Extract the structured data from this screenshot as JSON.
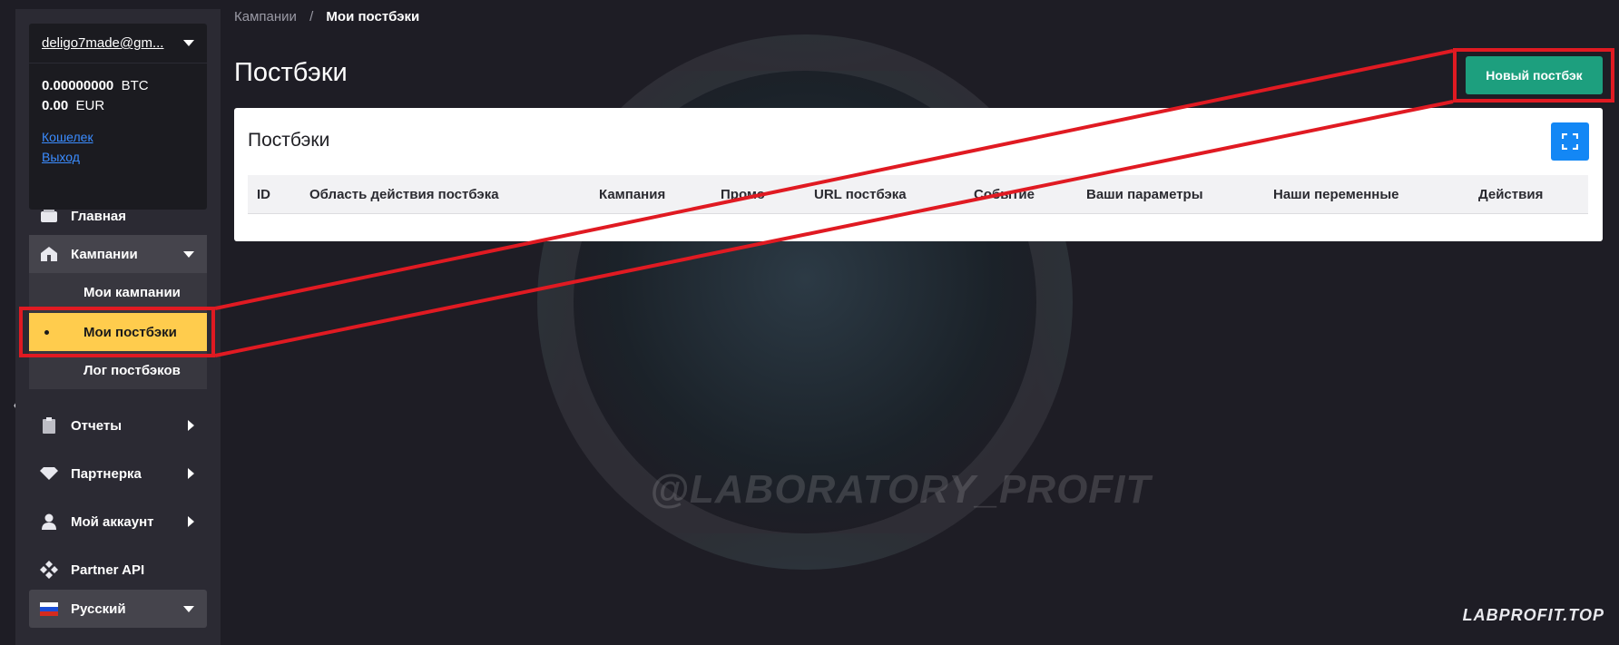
{
  "account": {
    "email": "deligo7made@gm...",
    "btc_amount": "0.00000000",
    "btc_currency": "BTC",
    "eur_amount": "0.00",
    "eur_currency": "EUR",
    "wallet_link": "Кошелек",
    "logout_link": "Выход"
  },
  "sidebar": {
    "home": "Главная",
    "campaigns": "Кампании",
    "campaigns_sub": [
      "Мои кампании",
      "Мои постбэки",
      "Лог постбэков"
    ],
    "reports": "Отчеты",
    "partner": "Партнерка",
    "my_account": "Мой аккаунт",
    "partner_api": "Partner API",
    "language": "Русский"
  },
  "breadcrumb": {
    "parent": "Кампании",
    "separator": "/",
    "current": "Мои постбэки"
  },
  "page": {
    "title": "Постбэки",
    "new_button": "Новый постбэк"
  },
  "card": {
    "title": "Постбэки",
    "columns": [
      "ID",
      "Область действия постбэка",
      "Кампания",
      "Промо",
      "URL постбэка",
      "Событие",
      "Ваши параметры",
      "Наши переменные",
      "Действия"
    ]
  },
  "watermark": {
    "handle": "@LABORATORY_PROFIT",
    "site": "LABPROFIT.TOP"
  },
  "colors": {
    "accent_green": "#1d9f7e",
    "active_yellow": "#ffcc4d",
    "annotation_red": "#e01a22",
    "fullscreen_blue": "#1387f5"
  }
}
